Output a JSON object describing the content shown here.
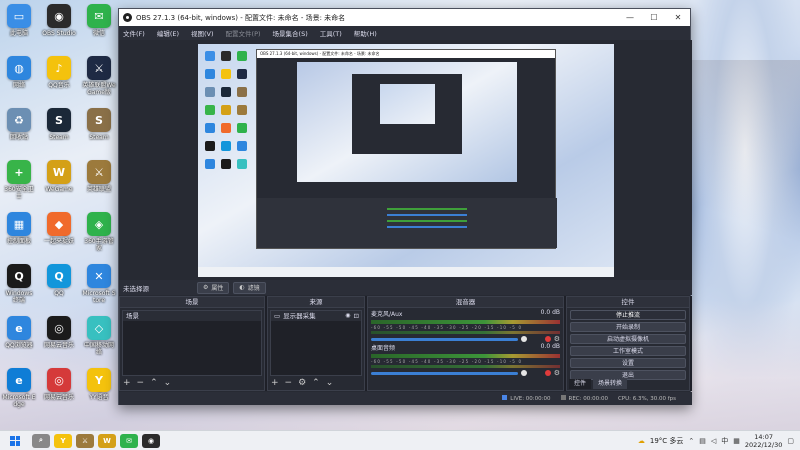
{
  "desktop": {
    "icons": [
      {
        "label": "此电脑",
        "glyph": "▭",
        "color": "#3a8ee6"
      },
      {
        "label": "OBS Studio",
        "glyph": "◉",
        "color": "#2b2b2b"
      },
      {
        "label": "微信",
        "glyph": "✉",
        "color": "#2fb24c"
      },
      {
        "label": "网络",
        "glyph": "◍",
        "color": "#2e86de"
      },
      {
        "label": "QQ音乐",
        "glyph": "♪",
        "color": "#f4c20d"
      },
      {
        "label": "英雄联盟WeGame版",
        "glyph": "⚔",
        "color": "#1e2a44"
      },
      {
        "label": "回收站",
        "glyph": "♻",
        "color": "#6c8fb3"
      },
      {
        "label": "Steam",
        "glyph": "S",
        "color": "#1b2838"
      },
      {
        "label": "Steam",
        "glyph": "S",
        "color": "#8a7048"
      },
      {
        "label": "360安全卫士",
        "glyph": "+",
        "color": "#38b449"
      },
      {
        "label": "WeGame",
        "glyph": "W",
        "color": "#d4a017"
      },
      {
        "label": "英雄联盟",
        "glyph": "⚔",
        "color": "#9c7a3c"
      },
      {
        "label": "控制面板",
        "glyph": "▦",
        "color": "#2e86de"
      },
      {
        "label": "一起来捉妖",
        "glyph": "◆",
        "color": "#f06a2b"
      },
      {
        "label": "360手游管家",
        "glyph": "◈",
        "color": "#2fb24c"
      },
      {
        "label": "Windows 终端",
        "glyph": "Q",
        "color": "#1b1b1b"
      },
      {
        "label": "QQ",
        "glyph": "Q",
        "color": "#1296db"
      },
      {
        "label": "Microsoft Store",
        "glyph": "✕",
        "color": "#2e86de"
      },
      {
        "label": "QQ浏览器",
        "glyph": "e",
        "color": "#2e86de"
      },
      {
        "label": "网易云音乐",
        "glyph": "◎",
        "color": "#1b1b1b"
      },
      {
        "label": "中国移动网络",
        "glyph": "◇",
        "color": "#38c0c0"
      },
      {
        "label": "Microsoft Edge",
        "glyph": "e",
        "color": "#0f7dd6"
      },
      {
        "label": "网易云音乐",
        "glyph": "◎",
        "color": "#d53a3a"
      },
      {
        "label": "YY语音",
        "glyph": "Y",
        "color": "#f4c20d"
      }
    ]
  },
  "obs": {
    "title": "OBS 27.1.3 (64-bit, windows) - 配置文件: 未命名 - 场景: 未命名",
    "window_controls": {
      "minimize": "—",
      "maximize": "☐",
      "close": "✕"
    },
    "menu": [
      {
        "label": "文件(F)",
        "disabled": false
      },
      {
        "label": "编辑(E)",
        "disabled": false
      },
      {
        "label": "视图(V)",
        "disabled": false
      },
      {
        "label": "配置文件(P)",
        "disabled": true
      },
      {
        "label": "场景集合(S)",
        "disabled": false
      },
      {
        "label": "工具(T)",
        "disabled": false
      },
      {
        "label": "帮助(H)",
        "disabled": false
      }
    ],
    "capture_title": "OBS 27.1.3 (64-bit, windows) - 配置文件: 未命名 - 场景: 未命名",
    "source_bar": {
      "text": "未选择源",
      "properties": "属性",
      "filters": "滤镜"
    },
    "scenes": {
      "header": "场景",
      "items": [
        "场景"
      ]
    },
    "sources": {
      "header": "来源",
      "items": [
        {
          "label": "显示器采集",
          "visible": true
        }
      ]
    },
    "mixer": {
      "header": "混音器",
      "channels": [
        {
          "name": "麦克风/Aux",
          "db": "0.0 dB",
          "level": 0.78
        },
        {
          "name": "桌面音频",
          "db": "0.0 dB",
          "level": 0.78
        }
      ],
      "ticks": "-60 -55 -50 -45 -40 -35 -30 -25 -20 -15 -10 -5 0"
    },
    "controls": {
      "header": "控件",
      "buttons": [
        "停止推流",
        "开始录制",
        "启动虚拟摄像机",
        "工作室模式",
        "设置",
        "退出"
      ],
      "tabs": [
        "控件",
        "场景转换"
      ]
    },
    "status": {
      "live": "LIVE: 00:00:00",
      "rec": "REC: 00:00:00",
      "cpu": "CPU: 6.3%, 30.00 fps"
    }
  },
  "taskbar": {
    "apps": [
      {
        "name": "search",
        "glyph": "⌕",
        "color": "#888"
      },
      {
        "name": "yy",
        "glyph": "Y",
        "color": "#f4c20d"
      },
      {
        "name": "lol",
        "glyph": "⚔",
        "color": "#9c7a3c"
      },
      {
        "name": "wegame",
        "glyph": "W",
        "color": "#d4a017"
      },
      {
        "name": "wechat",
        "glyph": "✉",
        "color": "#2fb24c"
      },
      {
        "name": "obs",
        "glyph": "◉",
        "color": "#2b2b2b"
      }
    ],
    "weather": "19°C 多云",
    "input_method": "中",
    "time": "14:07",
    "date": "2022/12/30"
  }
}
